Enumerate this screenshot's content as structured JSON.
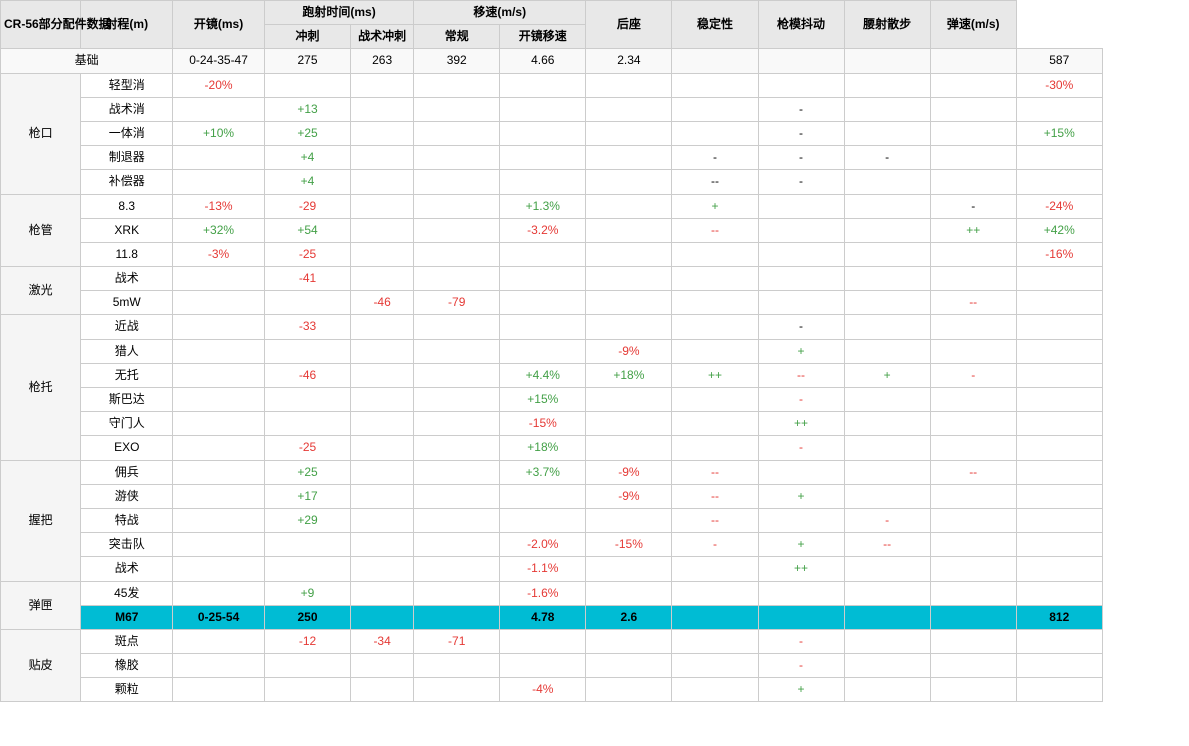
{
  "title": "CR-56部分配件数据",
  "headers": {
    "col0": "CR-56部分配件数据",
    "col1": "射程(m)",
    "col2": "开镜(ms)",
    "col3_group": "跑射时间(ms)",
    "col3a": "冲刺",
    "col3b": "战术冲刺",
    "col4_group": "移速(m/s)",
    "col4a": "常规",
    "col4b": "开镜移速",
    "col5": "后座",
    "col6": "稳定性",
    "col7": "枪模抖动",
    "col8": "腰射散步",
    "col9": "弹速(m/s)"
  },
  "base": {
    "label": "基础",
    "range": "0-24-35-47",
    "ads": "275",
    "sprint": "263",
    "tactical": "392",
    "move": "4.66",
    "ads_move": "2.34",
    "recoil": "",
    "stability": "",
    "shake": "",
    "hip": "",
    "velocity": "587"
  },
  "sections": [
    {
      "category": "枪口",
      "items": [
        {
          "name": "轻型消",
          "range_c": "red",
          "range": "-20%",
          "ads_c": "",
          "ads": "",
          "sprint_c": "",
          "sprint": "",
          "tactical_c": "",
          "tactical": "",
          "move_c": "",
          "move": "",
          "ads_move_c": "",
          "ads_move": "",
          "recoil_c": "",
          "recoil": "",
          "stability_c": "",
          "stability": "",
          "shake_c": "",
          "shake": "",
          "hip_c": "",
          "hip": "",
          "velocity_c": "red",
          "velocity": "-30%"
        },
        {
          "name": "战术消",
          "range_c": "",
          "range": "",
          "ads_c": "green",
          "ads": "+13",
          "sprint_c": "",
          "sprint": "",
          "tactical_c": "",
          "tactical": "",
          "move_c": "",
          "move": "",
          "ads_move_c": "",
          "ads_move": "",
          "recoil_c": "",
          "recoil": "",
          "stability_c": "",
          "stability": "-",
          "shake_c": "",
          "shake": "",
          "hip_c": "",
          "hip": "",
          "velocity_c": "",
          "velocity": ""
        },
        {
          "name": "一体消",
          "range_c": "green",
          "range": "+10%",
          "ads_c": "green",
          "ads": "+25",
          "sprint_c": "",
          "sprint": "",
          "tactical_c": "",
          "tactical": "",
          "move_c": "",
          "move": "",
          "ads_move_c": "",
          "ads_move": "",
          "recoil_c": "",
          "recoil": "",
          "stability_c": "",
          "stability": "-",
          "shake_c": "",
          "shake": "",
          "hip_c": "",
          "hip": "",
          "velocity_c": "green",
          "velocity": "+15%"
        },
        {
          "name": "制退器",
          "range_c": "",
          "range": "",
          "ads_c": "green",
          "ads": "+4",
          "sprint_c": "",
          "sprint": "",
          "tactical_c": "",
          "tactical": "",
          "move_c": "",
          "move": "",
          "ads_move_c": "",
          "ads_move": "",
          "recoil_c": "",
          "recoil": "-",
          "stability_c": "",
          "stability": "-",
          "shake_c": "",
          "shake": "-",
          "hip_c": "",
          "hip": "",
          "velocity_c": "",
          "velocity": ""
        },
        {
          "name": "补偿器",
          "range_c": "",
          "range": "",
          "ads_c": "green",
          "ads": "+4",
          "sprint_c": "",
          "sprint": "",
          "tactical_c": "",
          "tactical": "",
          "move_c": "",
          "move": "",
          "ads_move_c": "",
          "ads_move": "",
          "recoil_c": "",
          "recoil": "--",
          "stability_c": "",
          "stability": "-",
          "shake_c": "",
          "shake": "",
          "hip_c": "",
          "hip": "",
          "velocity_c": "",
          "velocity": ""
        }
      ]
    },
    {
      "category": "枪管",
      "items": [
        {
          "name": "8.3",
          "range_c": "red",
          "range": "-13%",
          "ads_c": "red",
          "ads": "-29",
          "sprint_c": "",
          "sprint": "",
          "tactical_c": "",
          "tactical": "",
          "move_c": "green",
          "move": "+1.3%",
          "ads_move_c": "",
          "ads_move": "",
          "recoil_c": "green",
          "recoil": "+",
          "stability_c": "",
          "stability": "",
          "shake_c": "",
          "shake": "",
          "hip_c": "",
          "hip": "-",
          "velocity_c": "red",
          "velocity": "-24%"
        },
        {
          "name": "XRK",
          "range_c": "green",
          "range": "+32%",
          "ads_c": "green",
          "ads": "+54",
          "sprint_c": "",
          "sprint": "",
          "tactical_c": "",
          "tactical": "",
          "move_c": "red",
          "move": "-3.2%",
          "ads_move_c": "",
          "ads_move": "",
          "recoil_c": "red",
          "recoil": "--",
          "stability_c": "",
          "stability": "",
          "shake_c": "",
          "shake": "",
          "hip_c": "green",
          "hip": "++",
          "velocity_c": "green",
          "velocity": "+42%"
        },
        {
          "name": "11.8",
          "range_c": "red",
          "range": "-3%",
          "ads_c": "red",
          "ads": "-25",
          "sprint_c": "",
          "sprint": "",
          "tactical_c": "",
          "tactical": "",
          "move_c": "",
          "move": "",
          "ads_move_c": "",
          "ads_move": "",
          "recoil_c": "",
          "recoil": "",
          "stability_c": "",
          "stability": "",
          "shake_c": "",
          "shake": "",
          "hip_c": "",
          "hip": "",
          "velocity_c": "red",
          "velocity": "-16%"
        }
      ]
    },
    {
      "category": "激光",
      "items": [
        {
          "name": "战术",
          "range_c": "",
          "range": "",
          "ads_c": "red",
          "ads": "-41",
          "sprint_c": "",
          "sprint": "",
          "tactical_c": "",
          "tactical": "",
          "move_c": "",
          "move": "",
          "ads_move_c": "",
          "ads_move": "",
          "recoil_c": "",
          "recoil": "",
          "stability_c": "",
          "stability": "",
          "shake_c": "",
          "shake": "",
          "hip_c": "",
          "hip": "",
          "velocity_c": "",
          "velocity": ""
        },
        {
          "name": "5mW",
          "range_c": "",
          "range": "",
          "ads_c": "",
          "ads": "",
          "sprint_c": "red",
          "sprint": "-46",
          "tactical_c": "red",
          "tactical": "-79",
          "move_c": "",
          "move": "",
          "ads_move_c": "",
          "ads_move": "",
          "recoil_c": "",
          "recoil": "",
          "stability_c": "",
          "stability": "",
          "shake_c": "",
          "shake": "",
          "hip_c": "red",
          "hip": "--",
          "velocity_c": "",
          "velocity": ""
        }
      ]
    },
    {
      "category": "枪托",
      "items": [
        {
          "name": "近战",
          "range_c": "",
          "range": "",
          "ads_c": "red",
          "ads": "-33",
          "sprint_c": "",
          "sprint": "",
          "tactical_c": "",
          "tactical": "",
          "move_c": "",
          "move": "",
          "ads_move_c": "",
          "ads_move": "",
          "recoil_c": "",
          "recoil": "",
          "stability_c": "",
          "stability": "-",
          "shake_c": "",
          "shake": "",
          "hip_c": "",
          "hip": "",
          "velocity_c": "",
          "velocity": ""
        },
        {
          "name": "猎人",
          "range_c": "",
          "range": "",
          "ads_c": "",
          "ads": "",
          "sprint_c": "",
          "sprint": "",
          "tactical_c": "",
          "tactical": "",
          "move_c": "",
          "move": "",
          "ads_move_c": "red",
          "ads_move": "-9%",
          "recoil_c": "",
          "recoil": "",
          "stability_c": "green",
          "stability": "+",
          "shake_c": "",
          "shake": "",
          "hip_c": "",
          "hip": "",
          "velocity_c": "",
          "velocity": ""
        },
        {
          "name": "无托",
          "range_c": "",
          "range": "",
          "ads_c": "red",
          "ads": "-46",
          "sprint_c": "",
          "sprint": "",
          "tactical_c": "",
          "tactical": "",
          "move_c": "green",
          "move": "+4.4%",
          "ads_move_c": "green",
          "ads_move": "+18%",
          "recoil_c": "green",
          "recoil": "++",
          "stability_c": "red",
          "stability": "--",
          "shake_c": "green",
          "shake": "+",
          "hip_c": "red",
          "hip": "-",
          "velocity_c": "",
          "velocity": ""
        },
        {
          "name": "斯巴达",
          "range_c": "",
          "range": "",
          "ads_c": "",
          "ads": "",
          "sprint_c": "",
          "sprint": "",
          "tactical_c": "",
          "tactical": "",
          "move_c": "green",
          "move": "+15%",
          "ads_move_c": "",
          "ads_move": "",
          "recoil_c": "",
          "recoil": "",
          "stability_c": "red",
          "stability": "-",
          "shake_c": "",
          "shake": "",
          "hip_c": "",
          "hip": "",
          "velocity_c": "",
          "velocity": ""
        },
        {
          "name": "守门人",
          "range_c": "",
          "range": "",
          "ads_c": "",
          "ads": "",
          "sprint_c": "",
          "sprint": "",
          "tactical_c": "",
          "tactical": "",
          "move_c": "red",
          "move": "-15%",
          "ads_move_c": "",
          "ads_move": "",
          "recoil_c": "",
          "recoil": "",
          "stability_c": "green",
          "stability": "++",
          "shake_c": "",
          "shake": "",
          "hip_c": "",
          "hip": "",
          "velocity_c": "",
          "velocity": ""
        },
        {
          "name": "EXO",
          "range_c": "",
          "range": "",
          "ads_c": "red",
          "ads": "-25",
          "sprint_c": "",
          "sprint": "",
          "tactical_c": "",
          "tactical": "",
          "move_c": "green",
          "move": "+18%",
          "ads_move_c": "",
          "ads_move": "",
          "recoil_c": "",
          "recoil": "",
          "stability_c": "red",
          "stability": "-",
          "shake_c": "",
          "shake": "",
          "hip_c": "",
          "hip": "",
          "velocity_c": "",
          "velocity": ""
        }
      ]
    },
    {
      "category": "握把",
      "items": [
        {
          "name": "佣兵",
          "range_c": "",
          "range": "",
          "ads_c": "green",
          "ads": "+25",
          "sprint_c": "",
          "sprint": "",
          "tactical_c": "",
          "tactical": "",
          "move_c": "green",
          "move": "+3.7%",
          "ads_move_c": "red",
          "ads_move": "-9%",
          "recoil_c": "red",
          "recoil": "--",
          "stability_c": "",
          "stability": "",
          "shake_c": "",
          "shake": "",
          "hip_c": "red",
          "hip": "--",
          "velocity_c": "",
          "velocity": ""
        },
        {
          "name": "游侠",
          "range_c": "",
          "range": "",
          "ads_c": "green",
          "ads": "+17",
          "sprint_c": "",
          "sprint": "",
          "tactical_c": "",
          "tactical": "",
          "move_c": "",
          "move": "",
          "ads_move_c": "red",
          "ads_move": "-9%",
          "recoil_c": "red",
          "recoil": "--",
          "stability_c": "green",
          "stability": "+",
          "shake_c": "",
          "shake": "",
          "hip_c": "",
          "hip": "",
          "velocity_c": "",
          "velocity": ""
        },
        {
          "name": "特战",
          "range_c": "",
          "range": "",
          "ads_c": "green",
          "ads": "+29",
          "sprint_c": "",
          "sprint": "",
          "tactical_c": "",
          "tactical": "",
          "move_c": "",
          "move": "",
          "ads_move_c": "",
          "ads_move": "",
          "recoil_c": "red",
          "recoil": "--",
          "stability_c": "",
          "stability": "",
          "shake_c": "red",
          "shake": "-",
          "hip_c": "",
          "hip": "",
          "velocity_c": "",
          "velocity": ""
        },
        {
          "name": "突击队",
          "range_c": "",
          "range": "",
          "ads_c": "",
          "ads": "",
          "sprint_c": "",
          "sprint": "",
          "tactical_c": "",
          "tactical": "",
          "move_c": "red",
          "move": "-2.0%",
          "ads_move_c": "red",
          "ads_move": "-15%",
          "recoil_c": "red",
          "recoil": "-",
          "stability_c": "green",
          "stability": "+",
          "shake_c": "red",
          "shake": "--",
          "hip_c": "",
          "hip": "",
          "velocity_c": "",
          "velocity": ""
        },
        {
          "name": "战术",
          "range_c": "",
          "range": "",
          "ads_c": "",
          "ads": "",
          "sprint_c": "",
          "sprint": "",
          "tactical_c": "",
          "tactical": "",
          "move_c": "red",
          "move": "-1.1%",
          "ads_move_c": "",
          "ads_move": "",
          "recoil_c": "",
          "recoil": "",
          "stability_c": "green",
          "stability": "++",
          "shake_c": "",
          "shake": "",
          "hip_c": "",
          "hip": "",
          "velocity_c": "",
          "velocity": ""
        }
      ]
    },
    {
      "category": "弹匣",
      "items": [
        {
          "name": "45发",
          "range_c": "",
          "range": "",
          "ads_c": "green",
          "ads": "+9",
          "sprint_c": "",
          "sprint": "",
          "tactical_c": "",
          "tactical": "",
          "move_c": "red",
          "move": "-1.6%",
          "ads_move_c": "",
          "ads_move": "",
          "recoil_c": "",
          "recoil": "",
          "stability_c": "",
          "stability": "",
          "shake_c": "",
          "shake": "",
          "hip_c": "",
          "hip": "",
          "velocity_c": "",
          "velocity": ""
        },
        {
          "name": "M67",
          "range_c": "",
          "range": "0-25-54",
          "ads_c": "",
          "ads": "250",
          "sprint_c": "",
          "sprint": "",
          "tactical_c": "",
          "tactical": "",
          "move_c": "",
          "move": "4.78",
          "ads_move_c": "",
          "ads_move": "2.6",
          "recoil_c": "",
          "recoil": "",
          "stability_c": "",
          "stability": "",
          "shake_c": "",
          "shake": "",
          "hip_c": "",
          "hip": "",
          "velocity_c": "",
          "velocity": "812",
          "highlighted": true
        }
      ]
    },
    {
      "category": "贴皮",
      "items": [
        {
          "name": "斑点",
          "range_c": "",
          "range": "",
          "ads_c": "red",
          "ads": "-12",
          "sprint_c": "red",
          "sprint": "-34",
          "tactical_c": "red",
          "tactical": "-71",
          "move_c": "",
          "move": "",
          "ads_move_c": "",
          "ads_move": "",
          "recoil_c": "",
          "recoil": "",
          "stability_c": "red",
          "stability": "-",
          "shake_c": "",
          "shake": "",
          "hip_c": "",
          "hip": "",
          "velocity_c": "",
          "velocity": ""
        },
        {
          "name": "橡胶",
          "range_c": "",
          "range": "",
          "ads_c": "",
          "ads": "",
          "sprint_c": "",
          "sprint": "",
          "tactical_c": "",
          "tactical": "",
          "move_c": "",
          "move": "",
          "ads_move_c": "",
          "ads_move": "",
          "recoil_c": "",
          "recoil": "",
          "stability_c": "red",
          "stability": "-",
          "shake_c": "",
          "shake": "",
          "hip_c": "",
          "hip": "",
          "velocity_c": "",
          "velocity": ""
        },
        {
          "name": "颗粒",
          "range_c": "",
          "range": "",
          "ads_c": "",
          "ads": "",
          "sprint_c": "",
          "sprint": "",
          "tactical_c": "",
          "tactical": "",
          "move_c": "red",
          "move": "-4%",
          "ads_move_c": "",
          "ads_move": "",
          "recoil_c": "",
          "recoil": "",
          "stability_c": "green",
          "stability": "+",
          "shake_c": "",
          "shake": "",
          "hip_c": "",
          "hip": "",
          "velocity_c": "",
          "velocity": ""
        }
      ]
    }
  ]
}
